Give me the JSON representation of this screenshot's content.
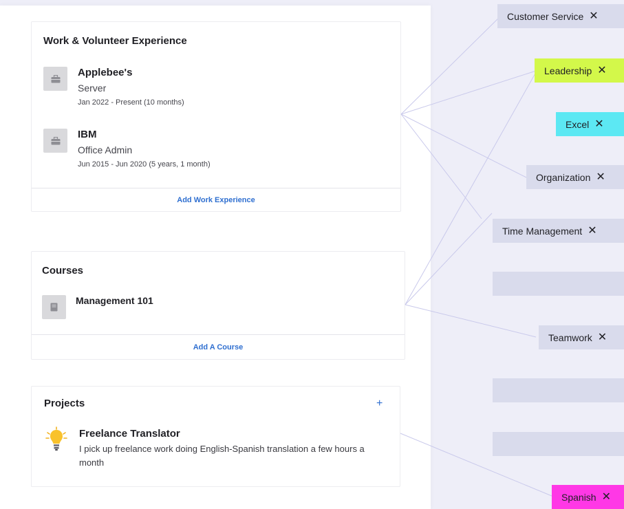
{
  "experience": {
    "title": "Work & Volunteer Experience",
    "items": [
      {
        "title": "Applebee's",
        "role": "Server",
        "dates": "Jan 2022 - Present (10 months)",
        "icon": "briefcase-icon"
      },
      {
        "title": "IBM",
        "role": "Office Admin",
        "dates": "Jun 2015 - Jun 2020 (5 years, 1 month)",
        "icon": "briefcase-icon"
      }
    ],
    "add_label": "Add Work Experience"
  },
  "courses": {
    "title": "Courses",
    "items": [
      {
        "title": "Management 101",
        "icon": "book-icon"
      }
    ],
    "add_label": "Add A Course"
  },
  "projects": {
    "title": "Projects",
    "add_symbol": "+",
    "items": [
      {
        "title": "Freelance Translator",
        "description": "I pick up freelance work doing English-Spanish translation a few hours a month",
        "icon": "lightbulb-icon"
      }
    ]
  },
  "skills": {
    "close_symbol": "✕",
    "tags": [
      {
        "label": "Customer Service",
        "color": "#d9dbec"
      },
      {
        "label": "Leadership",
        "color": "#d3f84a"
      },
      {
        "label": "Excel",
        "color": "#5ce8f3"
      },
      {
        "label": "Organization",
        "color": "#d9dbec"
      },
      {
        "label": "Time Management",
        "color": "#d9dbec"
      },
      {
        "label": "",
        "color": "#d9dbec"
      },
      {
        "label": "Teamwork",
        "color": "#d9dbec"
      },
      {
        "label": "",
        "color": "#d9dbec"
      },
      {
        "label": "",
        "color": "#d9dbec"
      },
      {
        "label": "Spanish",
        "color": "#ff38e6"
      }
    ]
  }
}
